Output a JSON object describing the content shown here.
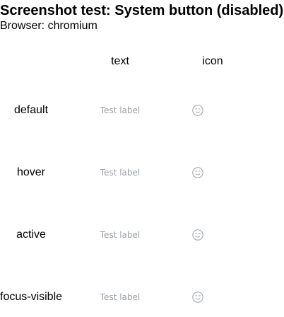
{
  "header": {
    "title": "Screenshot test: System button (disabled)",
    "subtitle": "Browser: chromium"
  },
  "columns": {
    "text": "text",
    "icon": "icon"
  },
  "rows": [
    {
      "state": "default",
      "button_label": "Test label",
      "icon": "smile-icon"
    },
    {
      "state": "hover",
      "button_label": "Test label",
      "icon": "smile-icon"
    },
    {
      "state": "active",
      "button_label": "Test label",
      "icon": "smile-icon"
    },
    {
      "state": "focus-visible",
      "button_label": "Test label",
      "icon": "smile-icon"
    }
  ],
  "colors": {
    "disabled_foreground": "#9aa0a6",
    "text": "#000000",
    "background": "#ffffff"
  }
}
